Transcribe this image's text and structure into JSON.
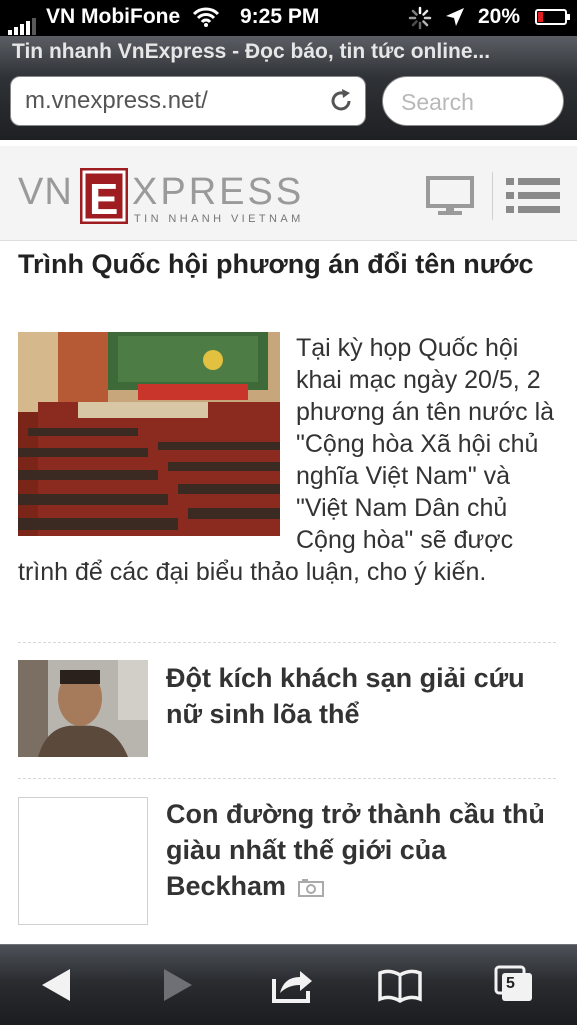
{
  "status_bar": {
    "carrier": "VN MobiFone",
    "time": "9:25 PM",
    "battery": "20%"
  },
  "browser": {
    "page_title": "Tin nhanh VnExpress - Đọc báo, tin tức online...",
    "url": "m.vnexpress.net/",
    "search_placeholder": "Search",
    "tab_count": "5"
  },
  "site": {
    "logo_text": "VNEXPRESS",
    "logo_tagline": "TIN NHANH VIETNAM",
    "brand_color": "#9f1d20"
  },
  "articles": {
    "main": {
      "title": "Trình Quốc hội phương án đổi tên nước",
      "summary": "Tại kỳ họp Quốc hội khai mạc ngày 20/5, 2 phương án tên nước là \"Cộng hòa Xã hội chủ nghĩa Việt Nam\" và \"Việt Nam Dân chủ Cộng hòa\" sẽ được trình để các đại biểu thảo luận, cho ý kiến."
    },
    "item2": {
      "title": "Đột kích khách sạn giải cứu nữ sinh lõa thể"
    },
    "item3": {
      "title": "Con đường trở thành cầu thủ giàu nhất thế giới của Beckham"
    }
  }
}
